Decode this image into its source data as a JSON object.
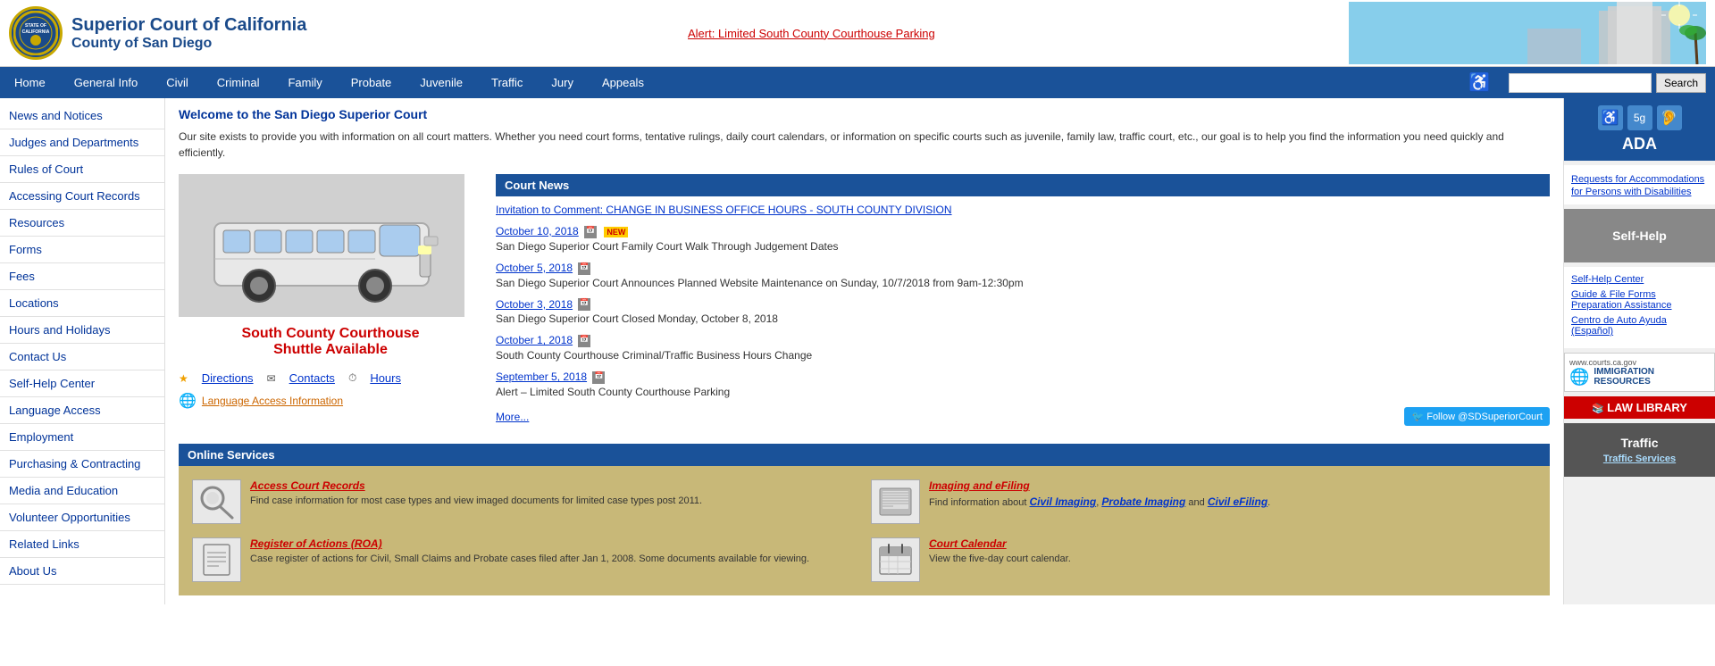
{
  "header": {
    "court_name_line1": "Superior Court of California",
    "court_name_line2": "County of San Diego",
    "alert_text": "Alert: Limited South County Courthouse Parking",
    "search_placeholder": "",
    "search_label": "Search"
  },
  "nav": {
    "items": [
      "Home",
      "General Info",
      "Civil",
      "Criminal",
      "Family",
      "Probate",
      "Juvenile",
      "Traffic",
      "Jury",
      "Appeals"
    ]
  },
  "sidebar": {
    "items": [
      "News and Notices",
      "Judges and Departments",
      "Rules of Court",
      "Accessing Court Records",
      "Resources",
      "Forms",
      "Fees",
      "Locations",
      "Hours and Holidays",
      "Contact Us",
      "Self-Help Center",
      "Language Access",
      "Employment",
      "Purchasing & Contracting",
      "Media and Education",
      "Volunteer Opportunities",
      "Related Links",
      "About Us"
    ]
  },
  "welcome": {
    "title": "Welcome to the San Diego Superior Court",
    "body": "Our site exists to provide you with information on all court matters.  Whether you need court forms, tentative rulings, daily court calendars, or information on specific courts such as juvenile, family law, traffic court, etc., our goal is to help you find the information you need quickly and efficiently."
  },
  "shuttle": {
    "title": "South County Courthouse",
    "title_line2": "Shuttle Available",
    "directions_label": "Directions",
    "contacts_label": "Contacts",
    "hours_label": "Hours",
    "language_access_label": "Language Access Information"
  },
  "court_news": {
    "header": "Court News",
    "items": [
      {
        "title": "Invitation to Comment: CHANGE IN BUSINESS OFFICE HOURS - SOUTH COUNTY DIVISION",
        "date": "",
        "body": "",
        "is_new": false,
        "is_link": true,
        "is_headline": true
      },
      {
        "date": "October 10, 2018",
        "body": "San Diego Superior Court Family Court Walk Through Judgement Dates",
        "is_new": true
      },
      {
        "date": "October 5, 2018",
        "body": "San Diego Superior Court Announces Planned Website Maintenance on Sunday, 10/7/2018 from 9am-12:30pm",
        "is_new": false
      },
      {
        "date": "October 3, 2018",
        "body": "San Diego Superior Court Closed Monday, October 8, 2018",
        "is_new": false
      },
      {
        "date": "October 1, 2018",
        "body": "South County Courthouse Criminal/Traffic Business Hours Change",
        "is_new": false
      },
      {
        "date": "September 5, 2018",
        "body": "Alert – Limited South County Courthouse Parking",
        "is_new": false
      }
    ],
    "more_label": "More...",
    "twitter_label": "Follow @SDSuperiorCourt"
  },
  "online_services": {
    "header": "Online Services",
    "items": [
      {
        "title": "Access Court Records",
        "description": "Find case information for most case types and view imaged documents for limited case types post 2011.",
        "icon": "🔍"
      },
      {
        "title": "Imaging and eFiling",
        "description": "Find information about Civil Imaging, Probate Imaging and Civil eFiling.",
        "icon": "🖼"
      },
      {
        "title": "Register of Actions (ROA)",
        "description": "Case register of actions for Civil, Small Claims and Probate cases filed after Jan 1, 2008. Some documents available for viewing.",
        "icon": "📋"
      },
      {
        "title": "Court Calendar",
        "description": "View the five-day court calendar.",
        "icon": "📅"
      }
    ]
  },
  "right_sidebar": {
    "ada_label": "ADA",
    "ada_link_text": "Requests for Accommodations for Persons with Disabilities",
    "self_help_label": "Self-Help",
    "self_help_links": [
      "Self-Help Center",
      "Guide & File Forms Preparation Assistance",
      "Centro de Auto Ayuda (Español)"
    ],
    "immigration_label": "www.courts.ca.gov",
    "immigration_sub": "IMMIGRATION RESOURCES",
    "law_library_label": "LAW LIBRARY",
    "traffic_label": "Traffic",
    "traffic_link": "Traffic Services"
  }
}
